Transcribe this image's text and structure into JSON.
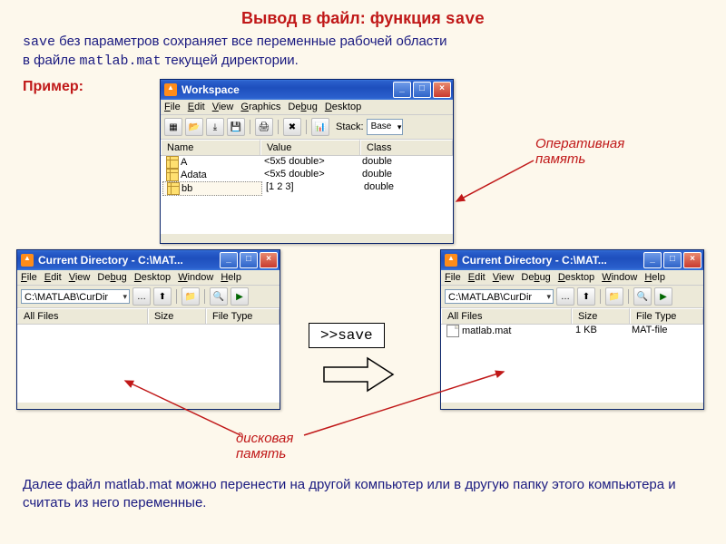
{
  "title_prefix": "Вывод в файл: функция ",
  "title_func": "save",
  "desc_line1a": "save",
  "desc_line1b": " без параметров сохраняет все переменные рабочей области",
  "desc_line2a": "в файле ",
  "desc_line2b": "matlab.mat",
  "desc_line2c": " текущей директории.",
  "example_label": "Пример:",
  "annot_ram": "Оперативная\nпамять",
  "annot_disk": "дисковая\nпамять",
  "save_command": ">>save",
  "footer": "Далее файл matlab.mat можно перенести на другой компьютер или в другую папку этого компьютера и считать из него переменные.",
  "menus": {
    "file": "File",
    "edit": "Edit",
    "view": "View",
    "graphics": "Graphics",
    "debug": "Debug",
    "desktop": "Desktop",
    "window": "Window",
    "help": "Help"
  },
  "workspace": {
    "title": "Workspace",
    "stack_label": "Stack:",
    "stack_value": "Base",
    "cols": {
      "name": "Name",
      "value": "Value",
      "class": "Class"
    },
    "rows": [
      {
        "name": "A",
        "value": "<5x5 double>",
        "class": "double"
      },
      {
        "name": "Adata",
        "value": "<5x5 double>",
        "class": "double"
      },
      {
        "name": "bb",
        "value": "[1 2 3]",
        "class": "double"
      }
    ]
  },
  "curdir": {
    "title": "Current Directory - C:\\MAT...",
    "path": "C:\\MATLAB\\CurDir",
    "cols": {
      "files": "All Files",
      "size": "Size",
      "type": "File Type"
    }
  },
  "curdir2": {
    "file": {
      "name": "matlab.mat",
      "size": "1 KB",
      "type": "MAT-file"
    }
  }
}
